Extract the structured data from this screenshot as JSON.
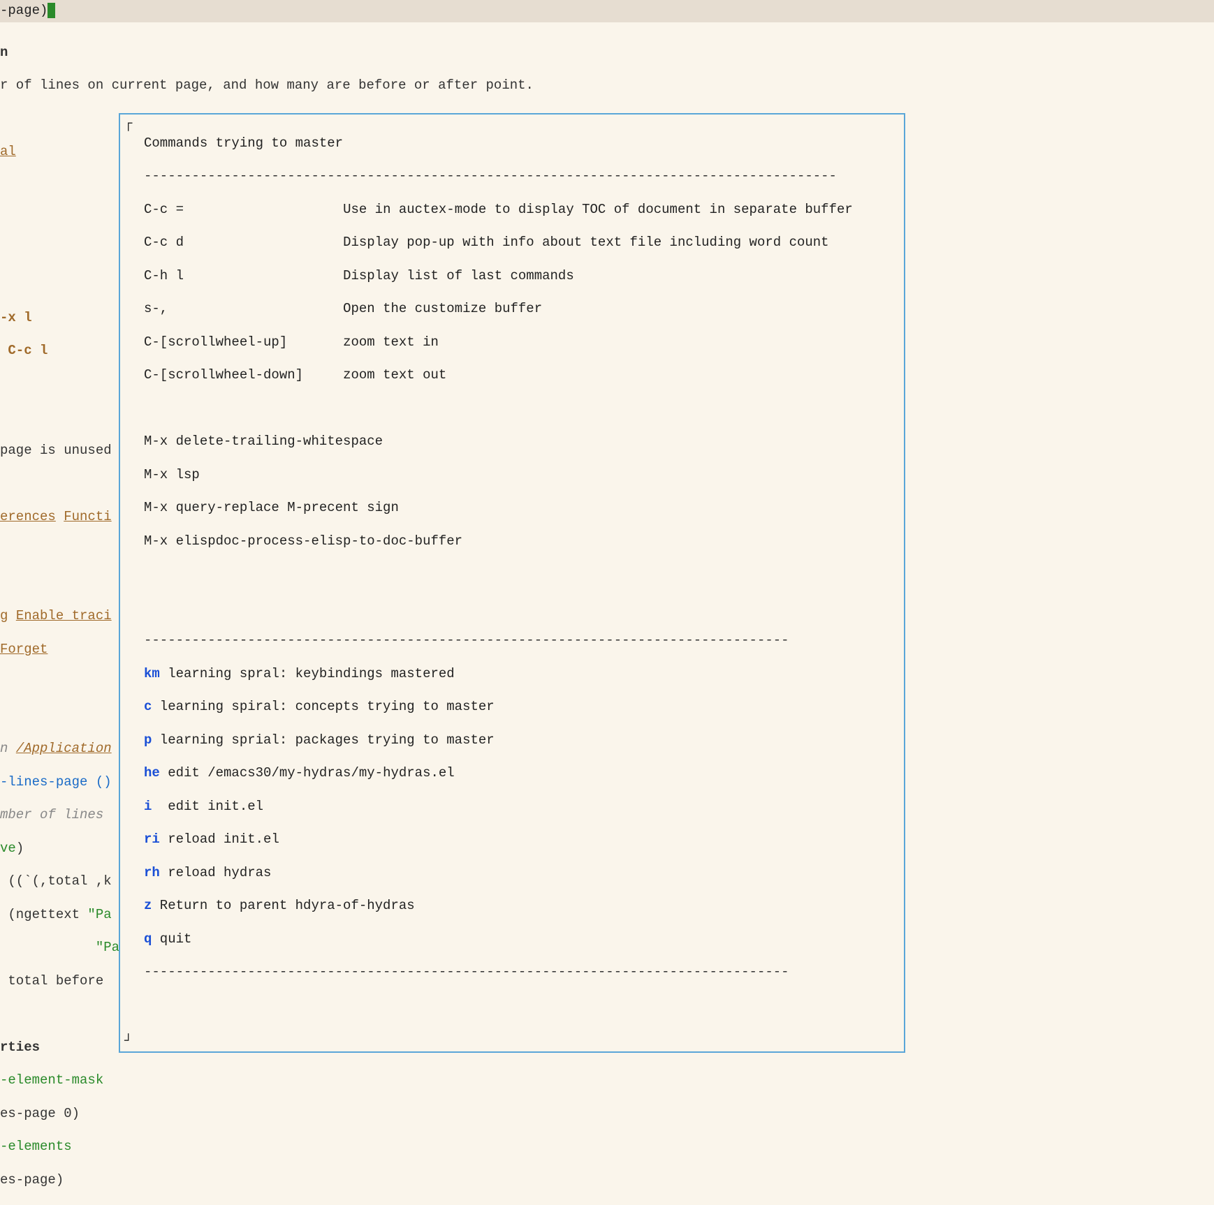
{
  "titlebar": {
    "text": "-page)"
  },
  "bg": {
    "l1": "n",
    "l2": "r of lines on current page, and how many are before or after point.",
    "l3": "al",
    "l4": "-x l",
    "l5": " C-c l",
    "l6": "page is unused",
    "l7a": "erences",
    "l7b": "Functi",
    "l8a": "g",
    "l8b": "Enable traci",
    "l9": "Forget",
    "l10a": "n ",
    "l10b": "/Application",
    "l11": "-lines-page ()",
    "l12": "mber of lines ",
    "l13": "ve",
    "l13b": ")",
    "l14": " ((`(,total ,k",
    "l15a": " (ngettext ",
    "l15b": "\"Pa",
    "l16": "\"Pa",
    "l17": " total before ",
    "l18": "rties",
    "l19": "-element-mask",
    "l20": "es-page 0)",
    "l21": "-elements",
    "l22": "es-page)"
  },
  "hydra": {
    "title": "Commands trying to master",
    "rule": "---------------------------------------------------------------------------------------",
    "rows": [
      {
        "key": "C-c =",
        "desc": "Use in auctex-mode to display TOC of document in separate buffer"
      },
      {
        "key": "C-c d",
        "desc": "Display pop-up with info about text file including word count"
      },
      {
        "key": "C-h l",
        "desc": "Display list of last commands"
      },
      {
        "key": "s-,",
        "desc": "Open the customize buffer"
      },
      {
        "key": "C-[scrollwheel-up]",
        "desc": "zoom text in"
      },
      {
        "key": "C-[scrollwheel-down]",
        "desc": "zoom text out"
      }
    ],
    "mx": [
      "M-x delete-trailing-whitespace",
      "M-x lsp",
      "M-x query-replace M-precent sign",
      "M-x elispdoc-process-elisp-to-doc-buffer"
    ],
    "rule2": "---------------------------------------------------------------------------------",
    "menu": [
      {
        "key": "km",
        "desc": " learning spral: keybindings mastered"
      },
      {
        "key": "c",
        "desc": " learning spiral: concepts trying to master"
      },
      {
        "key": "p",
        "desc": " learning sprial: packages trying to master"
      },
      {
        "key": "he",
        "desc": " edit /emacs30/my-hydras/my-hydras.el"
      },
      {
        "key": "i",
        "desc": "  edit init.el"
      },
      {
        "key": "ri",
        "desc": " reload init.el"
      },
      {
        "key": "rh",
        "desc": " reload hydras"
      },
      {
        "key": "z",
        "desc": " Return to parent hdyra-of-hydras"
      },
      {
        "key": "q",
        "desc": " quit"
      }
    ],
    "rule3": "---------------------------------------------------------------------------------"
  }
}
